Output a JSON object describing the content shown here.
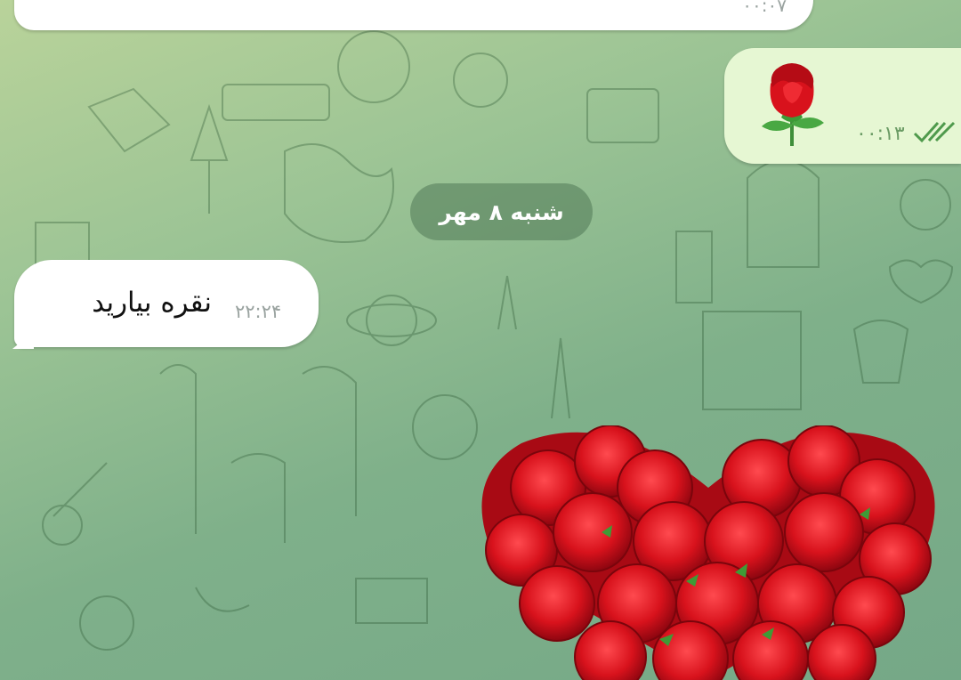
{
  "messages": {
    "top_incoming_time": "۰۰:۰۷",
    "outgoing_time": "۰۰:۱۳",
    "date_separator": "شنبه ۸ مهر",
    "incoming_text": "نقره بیارید",
    "incoming_time": "۲۲:۲۴"
  },
  "icons": {
    "rose_emoji": "rose-icon",
    "read_receipt": "double-check-icon",
    "heart_sticker": "rose-heart-sticker"
  },
  "colors": {
    "outgoing_bubble": "#e6f7d3",
    "incoming_bubble": "#ffffff",
    "rose_red": "#d8121c",
    "check_green": "#4f9a4c"
  }
}
